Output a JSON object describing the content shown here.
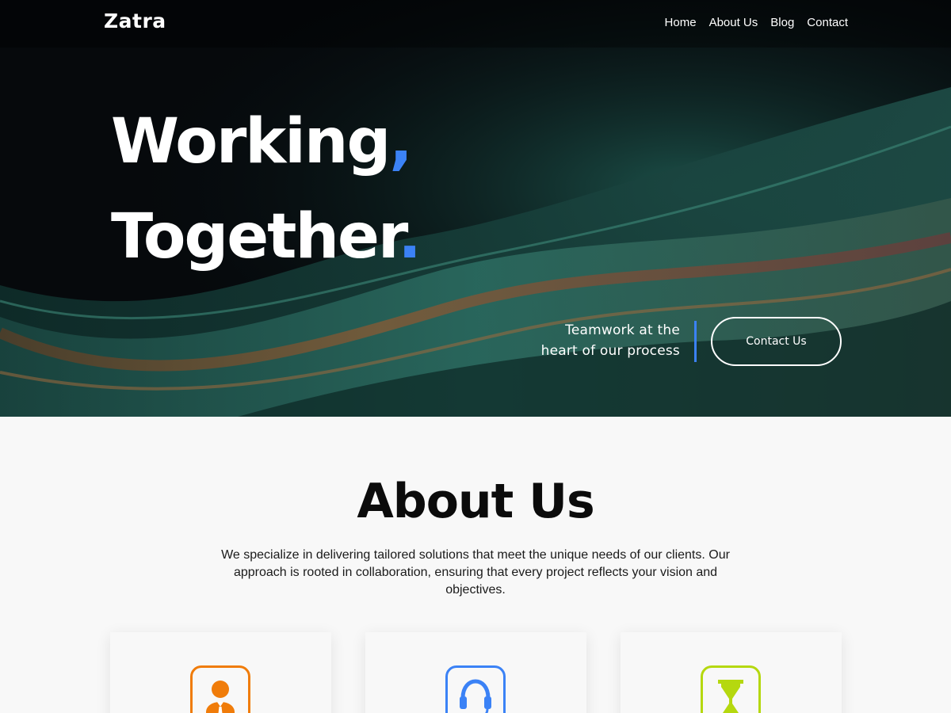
{
  "brand": {
    "name": "Zatra"
  },
  "nav": {
    "items": [
      "Home",
      "About Us",
      "Blog",
      "Contact"
    ]
  },
  "hero": {
    "line1": "Working",
    "line1_accent": ",",
    "line2": "Together",
    "line2_accent": ".",
    "tagline_line1": "Teamwork at the",
    "tagline_line2": "heart of our process",
    "cta_label": "Contact Us"
  },
  "about": {
    "title": "About Us",
    "description": "We specialize in delivering tailored solutions that meet the unique needs of our clients. Our approach is rooted in collaboration, ensuring that every project reflects your vision and objectives.",
    "cards": [
      {
        "icon": "person-icon",
        "color": "#f07c0a"
      },
      {
        "icon": "headset-icon",
        "color": "#3b82f6"
      },
      {
        "icon": "hourglass-icon",
        "color": "#b5d80f"
      }
    ]
  },
  "colors": {
    "accent": "#3b82f6",
    "hero_bg": "#06090c",
    "page_bg": "#f8f8f8"
  }
}
